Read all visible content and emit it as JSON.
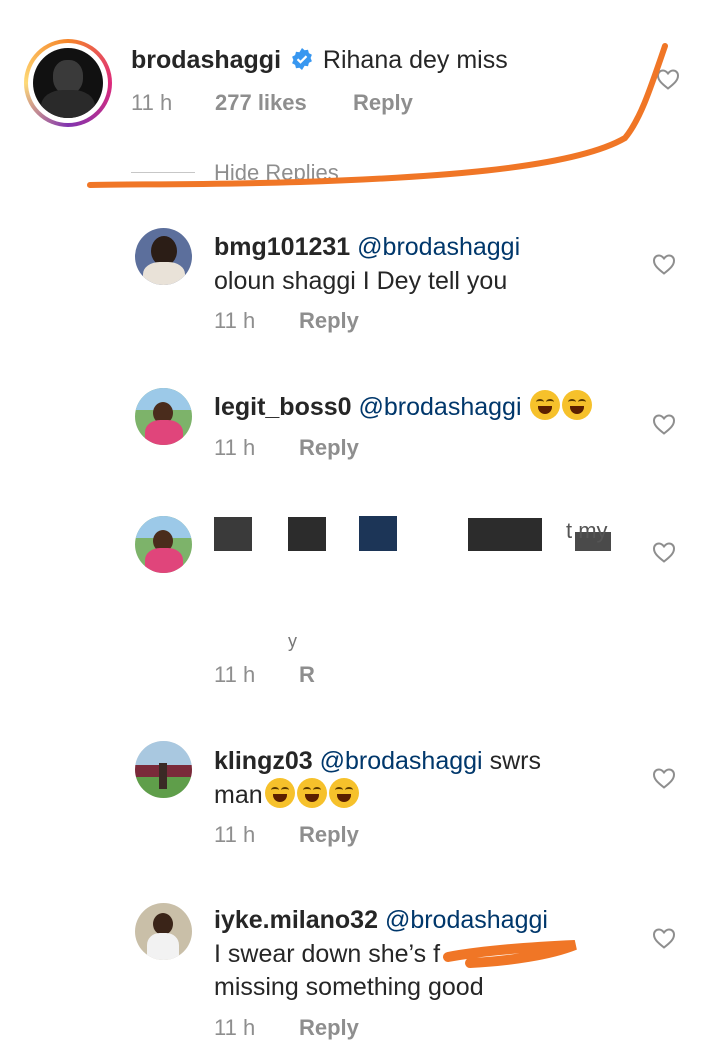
{
  "colors": {
    "accent_scribble": "#f07626",
    "mention": "#00376b",
    "meta": "#8e8e8e",
    "verified": "#3897f0"
  },
  "main_comment": {
    "username": "brodashaggi",
    "text": "Rihana dey miss",
    "time": "11 h",
    "likes": "277 likes",
    "reply_label": "Reply",
    "verified_icon": "verified-badge-icon",
    "hide_replies_label": "Hide Replies"
  },
  "replies": [
    {
      "username": "bmg101231",
      "mention": "@brodashaggi",
      "line1": "",
      "line2": "oloun shaggi I Dey tell you",
      "time": "11 h",
      "reply_label": "Reply"
    },
    {
      "username": "legit_boss0",
      "mention": "@brodashaggi",
      "emojis": "😂😂",
      "time": "11 h",
      "reply_label": "Reply"
    },
    {
      "redacted_tail": "t my",
      "partial_line": "y",
      "time": "11 h",
      "reply_label": "R"
    },
    {
      "username": "klingz03",
      "mention": "@brodashaggi",
      "line1_tail": "swrs",
      "line2": "man",
      "emojis": "😂😂😂",
      "time": "11 h",
      "reply_label": "Reply"
    },
    {
      "username": "iyke.milano32",
      "mention": "@brodashaggi",
      "line2": "I swear down she’s f",
      "line3": "missing something good",
      "time": "11 h",
      "reply_label": "Reply"
    }
  ]
}
